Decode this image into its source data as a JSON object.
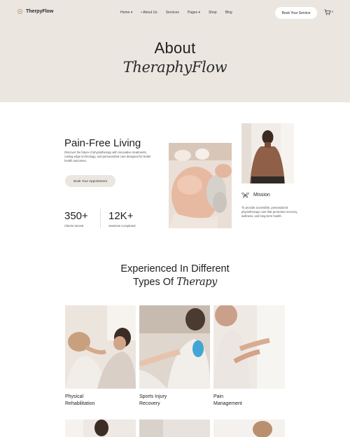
{
  "brand": {
    "name": "TherpyFlow"
  },
  "nav": {
    "items": [
      "Home",
      "About Us",
      "Services",
      "Pages",
      "Shop",
      "Blog"
    ],
    "cta": "Book Your Service",
    "cart_count": "0"
  },
  "hero": {
    "title": "About",
    "subtitle": "TheraphyFlow"
  },
  "about": {
    "title": "Pain-Free Living",
    "description": "Discover the future of physiotherapy with innovative treatments, cutting-edge technology, and personalized care designed for better health outcomes.",
    "cta": "Book Your Appointment",
    "stats": [
      {
        "value": "350+",
        "label": "Clients Served"
      },
      {
        "value": "12K+",
        "label": "Sessions Completed"
      }
    ],
    "mission": {
      "title": "Mission",
      "description": "To provide accessible, personalized physiotherapy care that promotes recovery, wellness, and long-term health."
    }
  },
  "services": {
    "heading_line1": "Experienced In Different",
    "heading_line2": "Types Of",
    "heading_script": "Therapy",
    "cards": [
      {
        "line1": "Physical",
        "line2": "Rehabilitation"
      },
      {
        "line1": "Sports Injury",
        "line2": "Recovery"
      },
      {
        "line1": "Pain",
        "line2": "Management"
      }
    ]
  }
}
